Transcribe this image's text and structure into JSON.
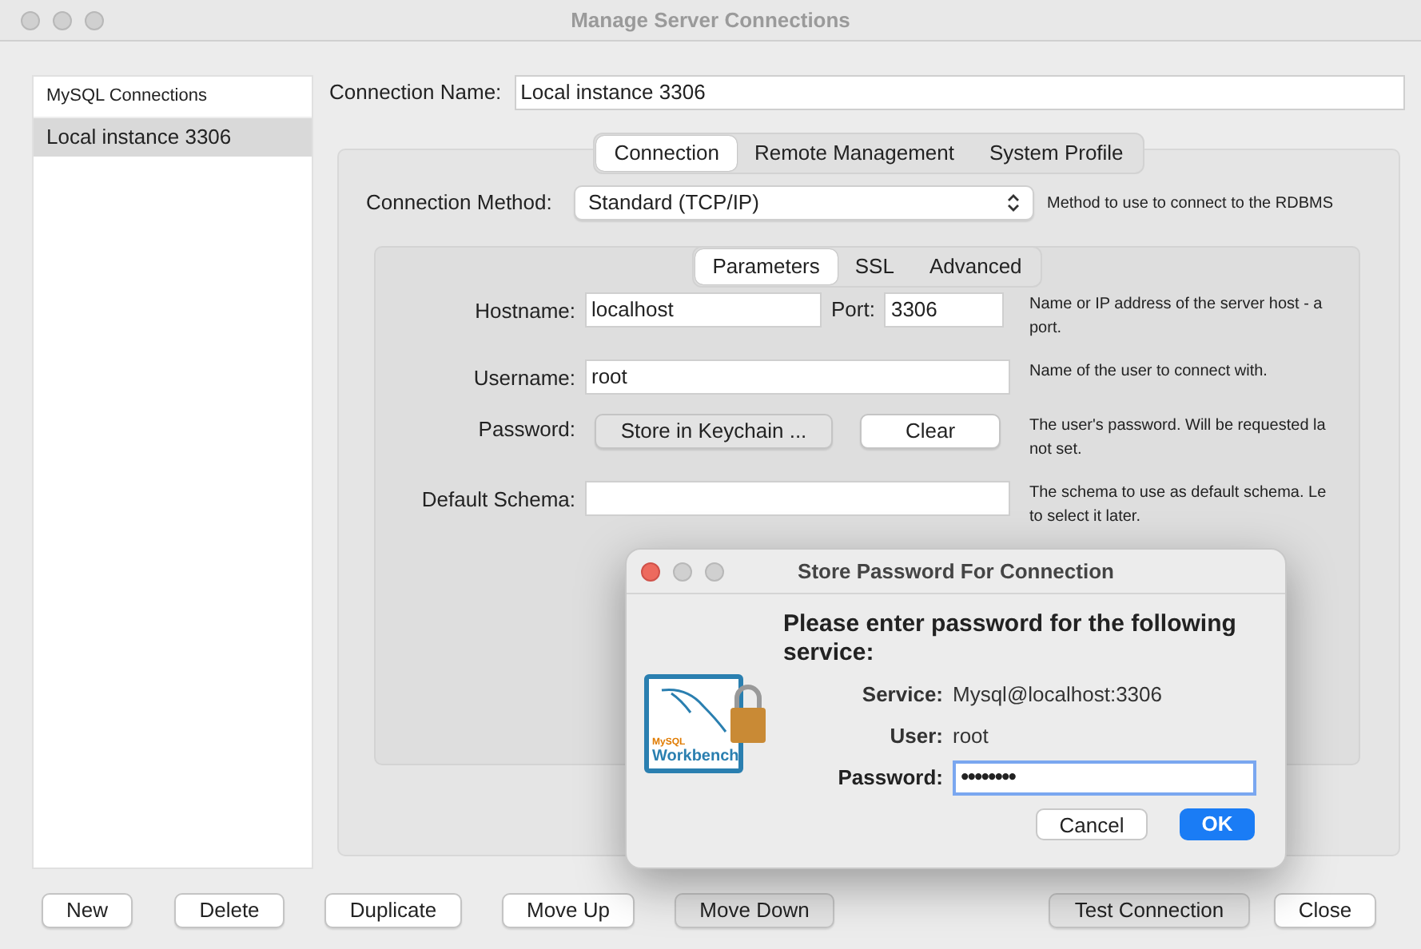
{
  "window": {
    "title": "Manage Server Connections"
  },
  "sidebar": {
    "header": "MySQL Connections",
    "items": [
      {
        "label": "Local instance 3306",
        "selected": true
      }
    ]
  },
  "connection_name": {
    "label": "Connection Name:",
    "value": "Local instance 3306"
  },
  "tabs": [
    {
      "label": "Connection",
      "selected": true
    },
    {
      "label": "Remote Management",
      "selected": false
    },
    {
      "label": "System Profile",
      "selected": false
    }
  ],
  "connection_method": {
    "label": "Connection Method:",
    "value": "Standard (TCP/IP)",
    "help": [
      "Method to use to connect to the RDBMS"
    ]
  },
  "subtabs": [
    {
      "label": "Parameters",
      "selected": true
    },
    {
      "label": "SSL",
      "selected": false
    },
    {
      "label": "Advanced",
      "selected": false
    }
  ],
  "parameters": {
    "hostname": {
      "label": "Hostname:",
      "value": "localhost"
    },
    "port": {
      "label": "Port:",
      "value": "3306"
    },
    "host_help": [
      "Name or IP address of the server host - a",
      "port."
    ],
    "username": {
      "label": "Username:",
      "value": "root",
      "help": [
        "Name of the user to connect with."
      ]
    },
    "password": {
      "label": "Password:",
      "buttons": [
        {
          "label": "Store in Keychain ...",
          "disabled": true
        },
        {
          "label": "Clear",
          "disabled": false
        }
      ],
      "help": [
        "The user's password. Will be requested la",
        "not set."
      ]
    },
    "schema": {
      "label": "Default Schema:",
      "help": [
        "The schema to use as default schema. Le",
        "to select it later."
      ]
    }
  },
  "dialog": {
    "title": "Store Password For Connection",
    "logo": [
      "MySQL",
      "Workbench"
    ],
    "heading": "Please enter password for the following service:",
    "fields": [
      {
        "label": "Service:",
        "value": "Mysql@localhost:3306"
      },
      {
        "label": "User:",
        "value": "root"
      }
    ],
    "password": {
      "label": "Password:",
      "value": "••••••••"
    },
    "buttons": [
      {
        "label": "Cancel",
        "kind": "normal"
      },
      {
        "label": "OK",
        "kind": "default"
      }
    ]
  },
  "buttons": [
    {
      "label": "New",
      "disabled": false
    },
    {
      "label": "Delete",
      "disabled": false
    },
    {
      "label": "Duplicate",
      "disabled": false
    },
    {
      "label": "Move Up",
      "disabled": false
    },
    {
      "label": "Move Down",
      "disabled": true
    },
    {
      "label": "Test Connection",
      "disabled": true
    },
    {
      "label": "Close",
      "disabled": false
    }
  ]
}
